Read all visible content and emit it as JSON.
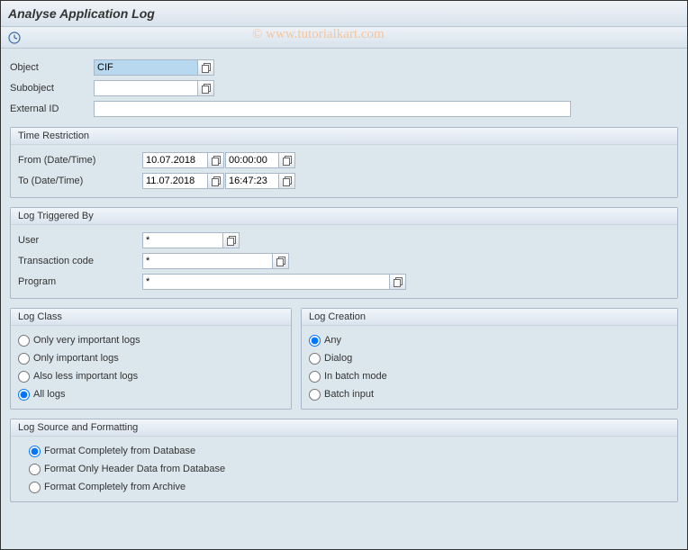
{
  "title": "Analyse Application Log",
  "watermark": "© www.tutorialkart.com",
  "fields": {
    "object_label": "Object",
    "object_value": "CIF",
    "subobject_label": "Subobject",
    "subobject_value": "",
    "externalid_label": "External ID",
    "externalid_value": ""
  },
  "time_restriction": {
    "title": "Time Restriction",
    "from_label": "From (Date/Time)",
    "from_date": "10.07.2018",
    "from_time": "00:00:00",
    "to_label": "To (Date/Time)",
    "to_date": "11.07.2018",
    "to_time": "16:47:23"
  },
  "log_triggered": {
    "title": "Log Triggered By",
    "user_label": "User",
    "user_value": "*",
    "tcode_label": "Transaction code",
    "tcode_value": "*",
    "program_label": "Program",
    "program_value": "*"
  },
  "log_class": {
    "title": "Log Class",
    "opt1": "Only very important logs",
    "opt2": "Only important logs",
    "opt3": "Also less important logs",
    "opt4": "All logs"
  },
  "log_creation": {
    "title": "Log Creation",
    "opt1": "Any",
    "opt2": "Dialog",
    "opt3": "In batch mode",
    "opt4": "Batch input"
  },
  "log_source": {
    "title": "Log Source and Formatting",
    "opt1": "Format Completely from Database",
    "opt2": "Format Only Header Data from Database",
    "opt3": "Format Completely from Archive"
  }
}
